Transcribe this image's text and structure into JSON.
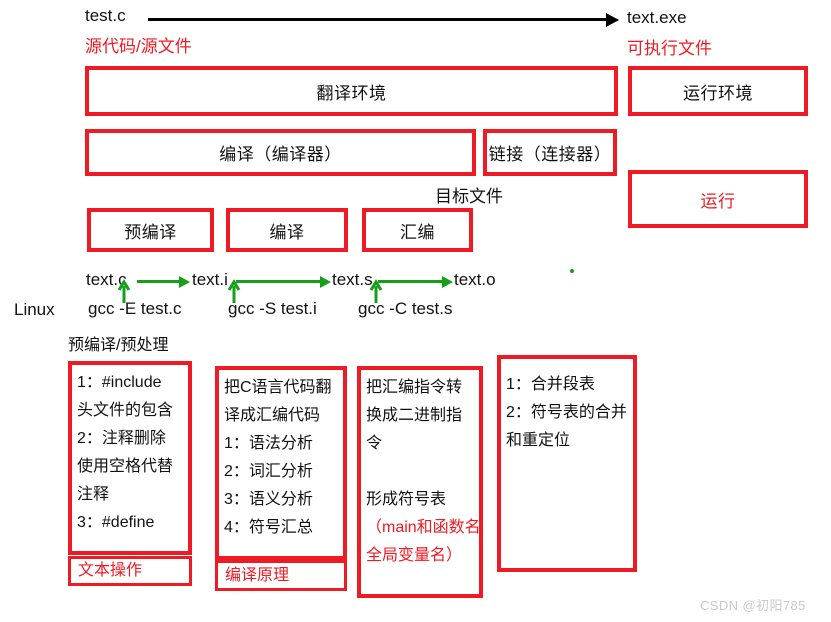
{
  "top_flow": {
    "source_file": "test.c",
    "source_file_note": "源代码/源文件",
    "exe_file": "text.exe",
    "exe_file_note": "可执行文件"
  },
  "environments": {
    "translate": "翻译环境",
    "runtime": "运行环境"
  },
  "stages": {
    "compile_phase": "编译（编译器）",
    "link_phase": "链接（连接器）",
    "object_file_note": "目标文件",
    "run": "运行"
  },
  "sub_stages": {
    "precompile": "预编译",
    "compile": "编译",
    "assemble": "汇编"
  },
  "linux_pipeline": {
    "platform": "Linux",
    "files": [
      "text.c",
      "text.i",
      "text.s",
      "text.o"
    ],
    "commands": [
      "gcc -E test.c",
      "gcc -S test.i",
      "gcc -C test.s"
    ],
    "caption": "预编译/预处理"
  },
  "detail_columns": [
    {
      "name": "precompile-detail",
      "lines": [
        "1：#include",
        "头文件的包含",
        "2：注释删除",
        "使用空格代替",
        "注释",
        "3：#define"
      ],
      "tag": "文本操作"
    },
    {
      "name": "compile-detail",
      "lines": [
        "把C语言代码翻",
        "译成汇编代码",
        "1：语法分析",
        "2：词汇分析",
        "3：语义分析",
        "4：符号汇总"
      ],
      "tag": "编译原理"
    },
    {
      "name": "assemble-detail",
      "lines": [
        "把汇编指令转",
        "换成二进制指",
        "令",
        "",
        "形成符号表"
      ],
      "red_lines": [
        "（main和函数名",
        "全局变量名）"
      ]
    },
    {
      "name": "link-detail",
      "lines": [
        "1：合并段表",
        "2：符号表的合并",
        "和重定位"
      ]
    }
  ],
  "watermark": "CSDN @初阳785",
  "colors": {
    "red": "#ee1b24",
    "green": "#16a019",
    "black": "#111111",
    "watermark": "#c9c9c9"
  }
}
